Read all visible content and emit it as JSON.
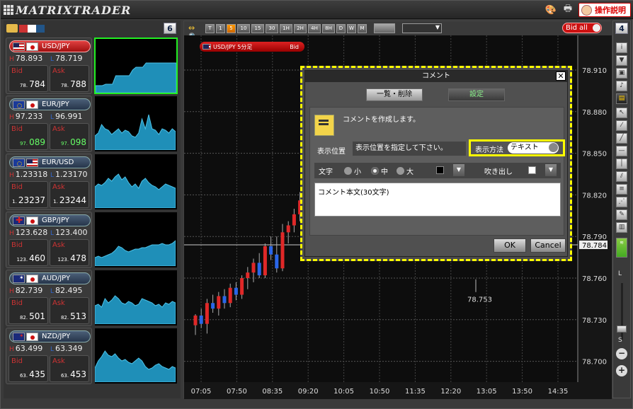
{
  "app": {
    "title": "MATRIXTRADER",
    "manual_label": "操作説明"
  },
  "left_panel": {
    "count": "6",
    "pairs": [
      {
        "name": "USD/JPY",
        "flags": [
          "us",
          "jp"
        ],
        "high": "78.893",
        "low": "78.719",
        "bid_prefix": "78.",
        "bid": "784",
        "ask_prefix": "78.",
        "ask": "788",
        "active": true,
        "spark": [
          10,
          10,
          10,
          12,
          12,
          12,
          24,
          24,
          24,
          24,
          24,
          32,
          36,
          36,
          36,
          42,
          42,
          42,
          42,
          42,
          42,
          42,
          42,
          42,
          42
        ]
      },
      {
        "name": "EUR/JPY",
        "flags": [
          "eu",
          "jp"
        ],
        "high": "97.233",
        "low": "96.991",
        "bid_prefix": "97.",
        "bid": "089",
        "ask_prefix": "97.",
        "ask": "098",
        "active": false,
        "spark": [
          20,
          24,
          36,
          30,
          28,
          22,
          26,
          30,
          24,
          28,
          26,
          20,
          18,
          24,
          44,
          30,
          50,
          30,
          28,
          22,
          30,
          28,
          24,
          30,
          26
        ]
      },
      {
        "name": "EUR/USD",
        "flags": [
          "eu",
          "us"
        ],
        "high": "1.23318",
        "low": "1.23170",
        "bid_prefix": "1.",
        "bid": "23237",
        "ask_prefix": "1.",
        "ask": "23244",
        "active": false,
        "spark": [
          30,
          34,
          32,
          36,
          42,
          38,
          44,
          48,
          40,
          44,
          36,
          30,
          34,
          28,
          38,
          42,
          36,
          32,
          30,
          26,
          30,
          34,
          32,
          30,
          28
        ]
      },
      {
        "name": "GBP/JPY",
        "flags": [
          "gb",
          "jp"
        ],
        "high": "123.628",
        "low": "123.400",
        "bid_prefix": "123.",
        "bid": "460",
        "ask_prefix": "123.",
        "ask": "478",
        "active": false,
        "spark": [
          12,
          14,
          12,
          14,
          16,
          18,
          22,
          28,
          26,
          22,
          20,
          22,
          24,
          24,
          26,
          26,
          28,
          30,
          30,
          30,
          32,
          30,
          30,
          32,
          36
        ]
      },
      {
        "name": "AUD/JPY",
        "flags": [
          "au",
          "jp"
        ],
        "high": "82.739",
        "low": "82.495",
        "bid_prefix": "82.",
        "bid": "501",
        "ask_prefix": "82.",
        "ask": "513",
        "active": false,
        "spark": [
          26,
          28,
          24,
          36,
          30,
          34,
          40,
          36,
          30,
          28,
          32,
          30,
          26,
          28,
          36,
          34,
          32,
          30,
          26,
          28,
          24,
          30,
          28,
          32,
          30
        ]
      },
      {
        "name": "NZD/JPY",
        "flags": [
          "nz",
          "jp"
        ],
        "high": "63.499",
        "low": "63.349",
        "bid_prefix": "63.",
        "bid": "435",
        "ask_prefix": "63.",
        "ask": "453",
        "active": false,
        "spark": [
          20,
          30,
          36,
          44,
          38,
          36,
          40,
          34,
          30,
          32,
          28,
          26,
          30,
          34,
          30,
          22,
          18,
          20,
          24,
          26,
          22,
          20,
          18,
          22,
          20
        ]
      }
    ],
    "hl_high_label": "H",
    "hl_low_label": "L",
    "bid_label": "Bid",
    "ask_label": "Ask"
  },
  "toolbar": {
    "timeframes": [
      "T",
      "1",
      "5",
      "10",
      "15",
      "30",
      "1H",
      "2H",
      "4H",
      "8H",
      "D",
      "W",
      "M"
    ],
    "active_timeframe": "5",
    "bid_all_label": "Bid all"
  },
  "chart": {
    "label_pair": "USD/JPY 5分足",
    "label_side": "Bid",
    "current_price_label": "78.784",
    "low_marker_label": "78.753",
    "chart_data": {
      "type": "candlestick",
      "y_ticks": [
        "78.910",
        "78.880",
        "78.850",
        "78.820",
        "78.790",
        "78.760",
        "78.730",
        "78.700"
      ],
      "x_ticks": [
        "07:05",
        "07:50",
        "08:35",
        "09:20",
        "10:05",
        "10:50",
        "11:35",
        "12:20",
        "13:05",
        "13:50",
        "14:35"
      ],
      "ylim": [
        78.685,
        78.935
      ],
      "candles": [
        [
          78.726,
          78.734,
          78.719,
          78.733
        ],
        [
          78.733,
          78.738,
          78.724,
          78.727
        ],
        [
          78.727,
          78.745,
          78.72,
          78.742
        ],
        [
          78.742,
          78.748,
          78.735,
          78.738
        ],
        [
          78.738,
          78.75,
          78.733,
          78.747
        ],
        [
          78.747,
          78.752,
          78.738,
          78.742
        ],
        [
          78.742,
          78.756,
          78.739,
          78.753
        ],
        [
          78.753,
          78.757,
          78.744,
          78.748
        ],
        [
          78.748,
          78.762,
          78.745,
          78.76
        ],
        [
          78.76,
          78.768,
          78.752,
          78.764
        ],
        [
          78.764,
          78.774,
          78.757,
          78.771
        ],
        [
          78.771,
          78.778,
          78.76,
          78.762
        ],
        [
          78.762,
          78.785,
          78.76,
          78.783
        ],
        [
          78.783,
          78.79,
          78.773,
          78.777
        ],
        [
          78.777,
          78.79,
          78.764,
          78.767
        ],
        [
          78.767,
          78.799,
          78.765,
          78.793
        ],
        [
          78.793,
          78.801,
          78.785,
          78.798
        ],
        [
          78.798,
          78.81,
          78.793,
          78.806
        ],
        [
          78.806,
          78.822,
          78.801,
          78.816
        ],
        [
          78.816,
          78.828,
          78.811,
          78.824
        ]
      ]
    }
  },
  "right_toolbar": {
    "count": "4",
    "zoom_large": "L",
    "zoom_small": "S"
  },
  "modal": {
    "title": "コメント",
    "tab_list": "一覧・削除",
    "tab_settings": "設定",
    "message": "コメントを作成します。",
    "position_label": "表示位置",
    "position_value": "表示位置を指定して下さい。",
    "method_label": "表示方法",
    "method_value": "テキスト",
    "font_label": "文字",
    "size_small": "小",
    "size_medium": "中",
    "size_large": "大",
    "balloon_label": "吹き出し",
    "comment_placeholder": "コメント本文(30文字)",
    "ok_label": "OK",
    "cancel_label": "Cancel"
  }
}
